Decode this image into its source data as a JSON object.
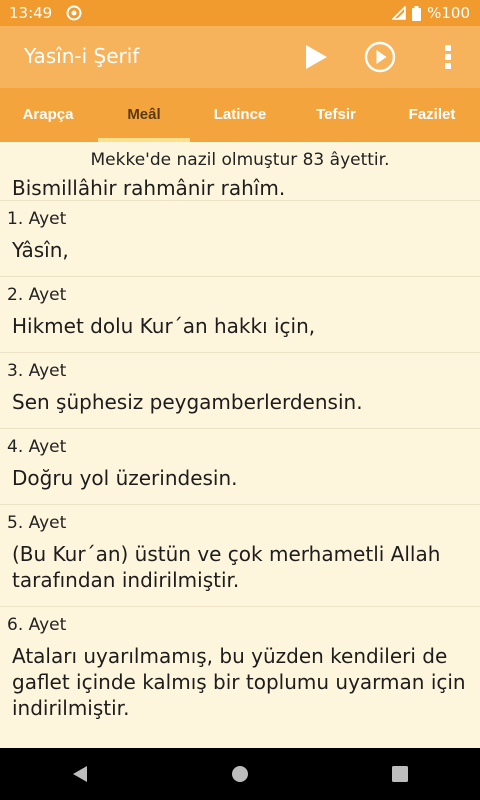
{
  "status_bar": {
    "time": "13:49",
    "battery": "%100"
  },
  "toolbar": {
    "title": "Yasîn-i Şerif"
  },
  "tabs": [
    {
      "label": "Arapça",
      "active": false
    },
    {
      "label": "Meâl",
      "active": true
    },
    {
      "label": "Latince",
      "active": false
    },
    {
      "label": "Tefsir",
      "active": false
    },
    {
      "label": "Fazilet",
      "active": false
    }
  ],
  "content": {
    "intro_note": "Mekke'de nazil olmuştur 83 âyettir.",
    "basmala": "Bismillâhir rahmânir rahîm.",
    "verses": [
      {
        "number": "1. Ayet",
        "text": "Yâsîn,"
      },
      {
        "number": "2. Ayet",
        "text": "Hikmet dolu Kur´an hakkı için,"
      },
      {
        "number": "3. Ayet",
        "text": "Sen şüphesiz peygamberlerdensin."
      },
      {
        "number": "4. Ayet",
        "text": "Doğru yol üzerindesin."
      },
      {
        "number": "5. Ayet",
        "text": "(Bu Kur´an) üstün ve çok merhametli Allah tarafından indirilmiştir."
      },
      {
        "number": "6. Ayet",
        "text": "Ataları uyarılmamış, bu yüzden kendileri de gaflet içinde kalmış bir toplumu uyarman için indirilmiştir."
      }
    ]
  },
  "colors": {
    "status_bar": "#f19a2e",
    "toolbar": "#f7b35c",
    "tabs": "#f4a43d",
    "tab_indicator": "#fbe08e",
    "background": "#fdf5dc"
  },
  "icons": {
    "toolbar": [
      "play-icon",
      "play-circle-icon",
      "more-vert-icon"
    ],
    "status": [
      "sync-icon",
      "signal-icon",
      "battery-icon"
    ],
    "nav": [
      "back-icon",
      "home-icon",
      "recents-icon"
    ]
  }
}
